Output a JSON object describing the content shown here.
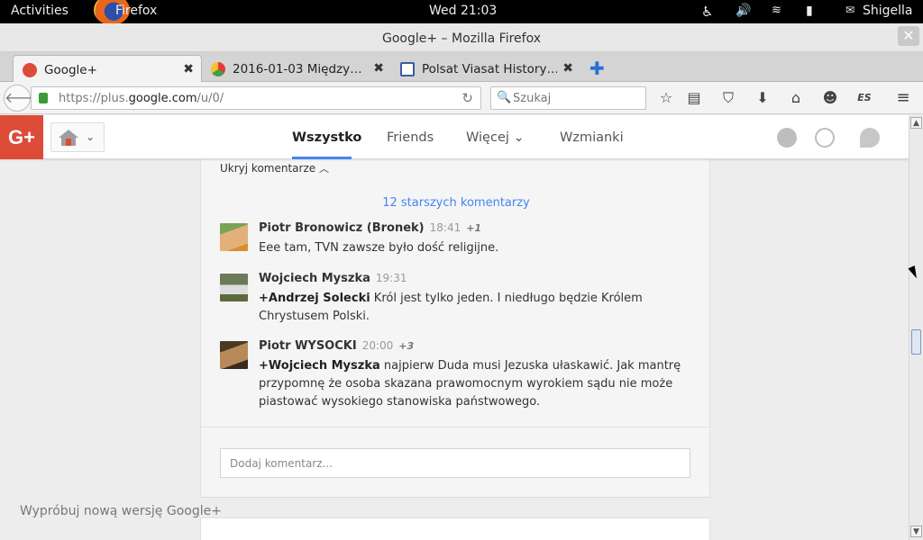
{
  "system_bar": {
    "activities": "Activities",
    "app_name": "Firefox",
    "clock": "Wed 21:03",
    "user": "Shigella"
  },
  "window": {
    "title": "Google+ – Mozilla Firefox",
    "close_symbol": "✕"
  },
  "tabs": [
    {
      "label": "Google+",
      "icon": "google-plus-icon",
      "close": "✖"
    },
    {
      "label": "2016-01-03 Między…",
      "icon": "picasa-icon",
      "close": "✖"
    },
    {
      "label": "Polsat Viasat History…",
      "icon": "tv-icon",
      "close": "✖"
    }
  ],
  "navbar": {
    "url_prefix": "https://plus.",
    "url_domain": "google.com",
    "url_suffix": "/u/0/",
    "search_placeholder": "Szukaj"
  },
  "gplus_header": {
    "logo": "G+",
    "nav": [
      "Wszystko",
      "Friends",
      "Więcej",
      "Wzmianki"
    ],
    "more_caret": "⌄"
  },
  "comments_section": {
    "hide_comments": "Ukryj komentarze",
    "older_comments": "12 starszych komentarzy",
    "comments": [
      {
        "author": "Piotr Bronowicz (Bronek)",
        "time": "18:41",
        "plus": "+1",
        "mention": "",
        "text": "Eee tam, TVN zawsze było dość religijne."
      },
      {
        "author": "Wojciech Myszka",
        "time": "19:31",
        "plus": "",
        "mention": "+Andrzej Solecki",
        "text": " Król jest tylko jeden. I niedługo będzie Królem Chrystusem Polski."
      },
      {
        "author": "Piotr WYSOCKI",
        "time": "20:00",
        "plus": "+3",
        "mention": "+Wojciech Myszka",
        "text": " najpierw Duda musi Jezuska ułaskawić. Jak mantrę przypomnę że osoba skazana prawomocnym wyrokiem sądu nie może piastować wysokiego stanowiska państwowego."
      }
    ],
    "add_comment_placeholder": "Dodaj komentarz..."
  },
  "footer_link": "Wypróbuj nową wersję Google+",
  "colors": {
    "gplus_red": "#dd4b39",
    "link_blue": "#4285f4"
  }
}
